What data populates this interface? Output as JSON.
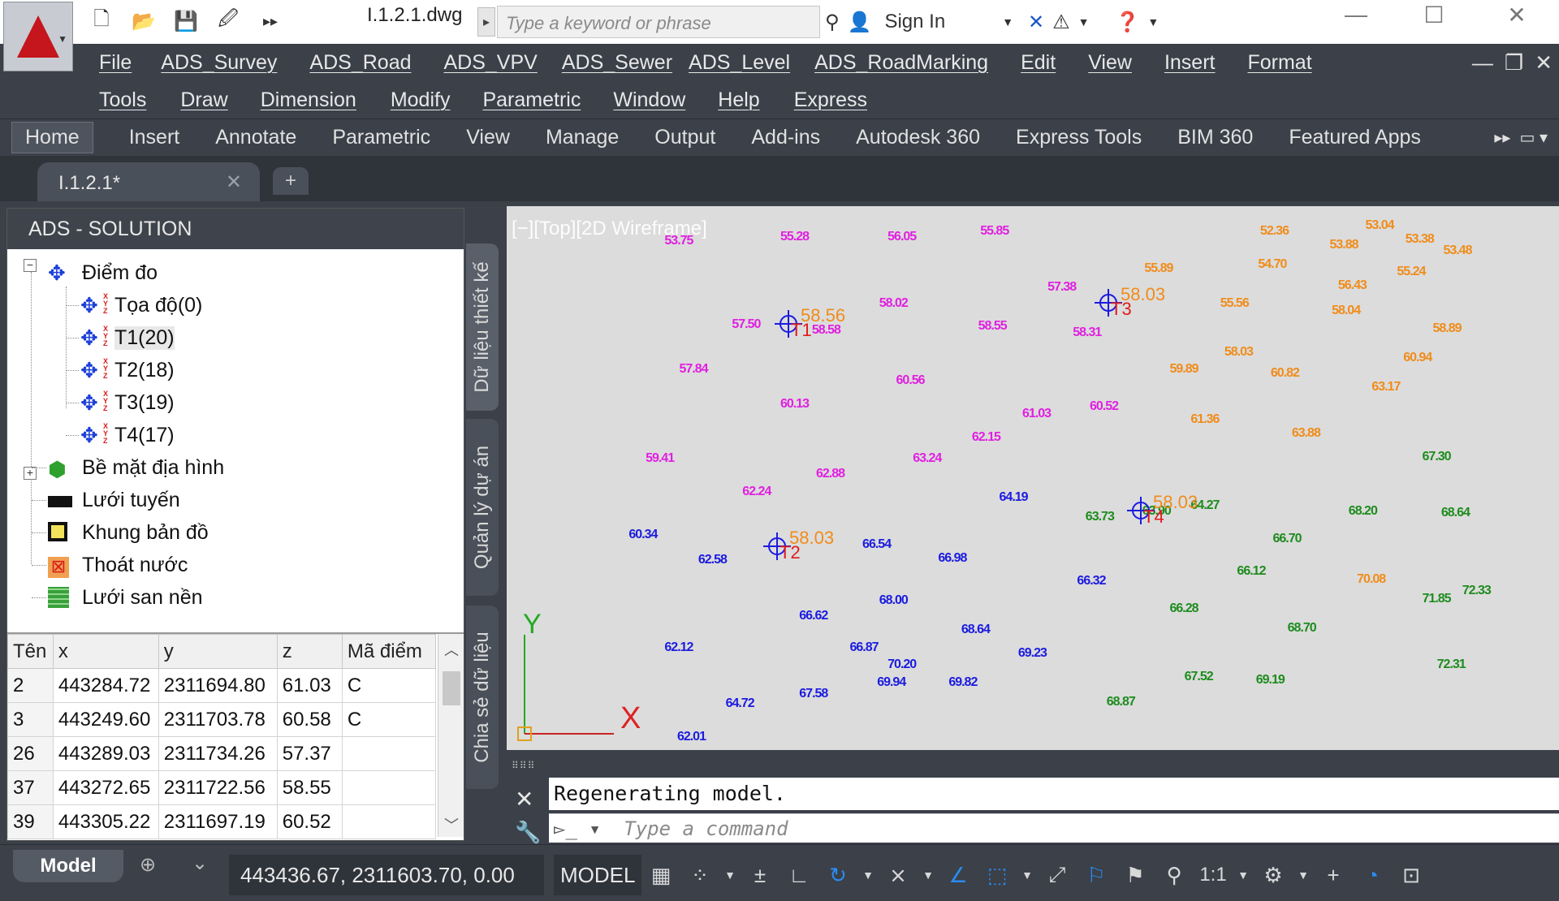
{
  "title_bar": {
    "document": "I.1.2.1.dwg",
    "search_placeholder": "Type a keyword or phrase",
    "sign_in": "Sign In"
  },
  "menu": {
    "row1": [
      "File",
      "ADS_Survey",
      "ADS_Road",
      "ADS_VPV",
      "ADS_Sewer",
      "ADS_Level",
      "ADS_RoadMarking",
      "Edit",
      "View",
      "Insert",
      "Format"
    ],
    "row2": [
      "Tools",
      "Draw",
      "Dimension",
      "Modify",
      "Parametric",
      "Window",
      "Help",
      "Express"
    ]
  },
  "ribbon_tabs": [
    "Home",
    "Insert",
    "Annotate",
    "Parametric",
    "View",
    "Manage",
    "Output",
    "Add-ins",
    "Autodesk 360",
    "Express Tools",
    "BIM 360",
    "Featured Apps"
  ],
  "file_tab": "I.1.2.1*",
  "panel": {
    "title": "ADS - SOLUTION",
    "tree": [
      {
        "label": "Điểm đo",
        "icon": "survey-point-icon"
      },
      {
        "label": "Tọa độ(0)",
        "icon": "xyz-point-icon"
      },
      {
        "label": "T1(20)",
        "icon": "xyz-point-icon"
      },
      {
        "label": "T2(18)",
        "icon": "xyz-point-icon"
      },
      {
        "label": "T3(19)",
        "icon": "xyz-point-icon"
      },
      {
        "label": "T4(17)",
        "icon": "xyz-point-icon"
      },
      {
        "label": "Bề mặt địa hình",
        "icon": "terrain-surface-icon"
      },
      {
        "label": "Lưới tuyến",
        "icon": "route-grid-icon"
      },
      {
        "label": "Khung bản đồ",
        "icon": "map-frame-icon"
      },
      {
        "label": "Thoát nước",
        "icon": "drainage-icon"
      },
      {
        "label": "Lưới san nền",
        "icon": "grading-grid-icon"
      }
    ],
    "table": {
      "headers": [
        "Tên",
        "x",
        "y",
        "z",
        "Mã điểm"
      ],
      "rows": [
        [
          "2",
          "443284.72",
          "2311694.80",
          "61.03",
          "C"
        ],
        [
          "3",
          "443249.60",
          "2311703.78",
          "60.58",
          "C"
        ],
        [
          "26",
          "443289.03",
          "2311734.26",
          "57.37",
          ""
        ],
        [
          "37",
          "443272.65",
          "2311722.56",
          "58.55",
          ""
        ],
        [
          "39",
          "443305.22",
          "2311697.19",
          "60.52",
          ""
        ]
      ]
    }
  },
  "side_tabs": [
    "Dữ liệu thiết kế",
    "Quản lý dự án",
    "Chia sẻ dữ liệu"
  ],
  "viewport": {
    "label": "[−][Top][2D Wireframe]",
    "colors": {
      "magenta": "#e020e0",
      "orange": "#f08c1a",
      "blue": "#1b1be0",
      "green": "#1e8c1e"
    },
    "elevations": [
      {
        "t": "55.28",
        "c": "magenta"
      },
      {
        "t": "56.05",
        "c": "magenta"
      },
      {
        "t": "55.85",
        "c": "magenta"
      },
      {
        "t": "53.75",
        "c": "magenta"
      },
      {
        "t": "52.36",
        "c": "orange"
      },
      {
        "t": "53.04",
        "c": "orange"
      },
      {
        "t": "53.38",
        "c": "orange"
      },
      {
        "t": "53.88",
        "c": "orange"
      },
      {
        "t": "53.48",
        "c": "orange"
      },
      {
        "t": "55.89",
        "c": "orange"
      },
      {
        "t": "54.70",
        "c": "orange"
      },
      {
        "t": "55.24",
        "c": "orange"
      },
      {
        "t": "57.38",
        "c": "magenta"
      },
      {
        "t": "56.43",
        "c": "orange"
      },
      {
        "t": "55.56",
        "c": "orange"
      },
      {
        "t": "58.04",
        "c": "orange"
      },
      {
        "t": "58.02",
        "c": "magenta"
      },
      {
        "t": "57.50",
        "c": "magenta"
      },
      {
        "t": "58.58",
        "c": "magenta"
      },
      {
        "t": "58.55",
        "c": "magenta"
      },
      {
        "t": "58.31",
        "c": "magenta"
      },
      {
        "t": "58.89",
        "c": "orange"
      },
      {
        "t": "58.03",
        "c": "orange"
      },
      {
        "t": "60.94",
        "c": "orange"
      },
      {
        "t": "57.84",
        "c": "magenta"
      },
      {
        "t": "60.56",
        "c": "magenta"
      },
      {
        "t": "59.89",
        "c": "orange"
      },
      {
        "t": "60.82",
        "c": "orange"
      },
      {
        "t": "63.17",
        "c": "orange"
      },
      {
        "t": "60.13",
        "c": "magenta"
      },
      {
        "t": "61.03",
        "c": "magenta"
      },
      {
        "t": "60.52",
        "c": "magenta"
      },
      {
        "t": "61.36",
        "c": "orange"
      },
      {
        "t": "62.15",
        "c": "magenta"
      },
      {
        "t": "63.88",
        "c": "orange"
      },
      {
        "t": "59.41",
        "c": "magenta"
      },
      {
        "t": "63.24",
        "c": "magenta"
      },
      {
        "t": "62.88",
        "c": "magenta"
      },
      {
        "t": "67.30",
        "c": "green"
      },
      {
        "t": "62.24",
        "c": "magenta"
      },
      {
        "t": "64.19",
        "c": "blue"
      },
      {
        "t": "63.73",
        "c": "green"
      },
      {
        "t": "63.90",
        "c": "green"
      },
      {
        "t": "64.27",
        "c": "green"
      },
      {
        "t": "68.20",
        "c": "green"
      },
      {
        "t": "68.64",
        "c": "green"
      },
      {
        "t": "60.34",
        "c": "blue"
      },
      {
        "t": "66.54",
        "c": "blue"
      },
      {
        "t": "66.98",
        "c": "blue"
      },
      {
        "t": "66.70",
        "c": "green"
      },
      {
        "t": "62.58",
        "c": "blue"
      },
      {
        "t": "66.32",
        "c": "blue"
      },
      {
        "t": "66.12",
        "c": "green"
      },
      {
        "t": "70.08",
        "c": "orange"
      },
      {
        "t": "72.33",
        "c": "green"
      },
      {
        "t": "68.00",
        "c": "blue"
      },
      {
        "t": "71.85",
        "c": "green"
      },
      {
        "t": "66.28",
        "c": "green"
      },
      {
        "t": "66.62",
        "c": "blue"
      },
      {
        "t": "68.64",
        "c": "blue"
      },
      {
        "t": "68.70",
        "c": "green"
      },
      {
        "t": "62.12",
        "c": "blue"
      },
      {
        "t": "66.87",
        "c": "blue"
      },
      {
        "t": "69.23",
        "c": "blue"
      },
      {
        "t": "70.20",
        "c": "blue"
      },
      {
        "t": "72.31",
        "c": "green"
      },
      {
        "t": "67.52",
        "c": "green"
      },
      {
        "t": "69.19",
        "c": "green"
      },
      {
        "t": "69.94",
        "c": "blue"
      },
      {
        "t": "69.82",
        "c": "blue"
      },
      {
        "t": "67.58",
        "c": "blue"
      },
      {
        "t": "64.72",
        "c": "blue"
      },
      {
        "t": "68.87",
        "c": "green"
      },
      {
        "t": "62.01",
        "c": "blue"
      }
    ],
    "stations": [
      {
        "name": "T1",
        "elev": "58.56"
      },
      {
        "name": "T2",
        "elev": "58.03"
      },
      {
        "name": "T3",
        "elev": "58.03"
      },
      {
        "name": "T4",
        "elev": "58.03"
      }
    ],
    "ucs": {
      "x": "X",
      "y": "Y"
    }
  },
  "command": {
    "history": "Regenerating model.",
    "placeholder": "Type a command"
  },
  "status": {
    "model_tab": "Model",
    "coords": "443436.67, 2311603.70, 0.00",
    "mode": "MODEL",
    "scale": "1:1"
  }
}
